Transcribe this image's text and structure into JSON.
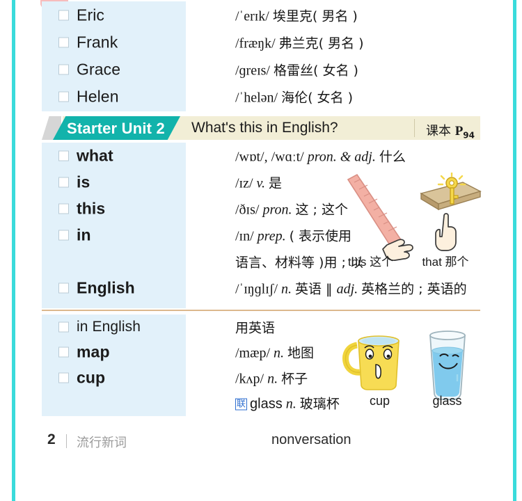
{
  "page": {
    "footer_number": "2",
    "footer_category": "流行新词",
    "footer_word": "nonversation"
  },
  "top_entries": [
    {
      "word": "Eric",
      "bold": false,
      "ipa": "/ˈerɪk/",
      "gloss": "埃里克( 男名 )"
    },
    {
      "word": "Frank",
      "bold": false,
      "ipa": "/fræŋk/",
      "gloss": "弗兰克( 男名 )"
    },
    {
      "word": "Grace",
      "bold": false,
      "ipa": "/ɡreɪs/",
      "gloss": "格雷丝( 女名 )"
    },
    {
      "word": "Helen",
      "bold": false,
      "ipa": "/ˈhelən/",
      "gloss": "海伦( 女名 )"
    }
  ],
  "unit": {
    "label": "Starter Unit 2",
    "subtitle": "What's this in English?",
    "book_label": "课本",
    "page_prefix": "P",
    "page_number": "94"
  },
  "unit_entries": [
    {
      "word": "what",
      "bold": true,
      "ipa": "/wɒt/, /wɑːt/",
      "pos": "pron. & adj.",
      "gloss": "什么"
    },
    {
      "word": "is",
      "bold": true,
      "ipa": "/ɪz/",
      "pos": "v.",
      "gloss": "是"
    },
    {
      "word": "this",
      "bold": true,
      "ipa": "/ðɪs/",
      "pos": "pron.",
      "gloss": "这 ; 这个"
    },
    {
      "word": "in",
      "bold": true,
      "ipa": "/ɪn/",
      "pos": "prep.",
      "gloss": "( 表示使用"
    },
    {
      "word": "",
      "bold": true,
      "ipa": "",
      "pos": "",
      "gloss": "语言、材料等 )用 ; 以"
    },
    {
      "word": "English",
      "bold": true,
      "ipa": "/ˈɪŋɡlɪʃ/",
      "pos": "n.",
      "gloss": "英语 ‖ ",
      "pos2": "adj.",
      "gloss2": "英格兰的 ; 英语的"
    }
  ],
  "phrase_entries": [
    {
      "word": "in English",
      "bold": false,
      "ipa": "",
      "pos": "",
      "gloss": "用英语"
    },
    {
      "word": "map",
      "bold": true,
      "ipa": "/mæp/",
      "pos": "n.",
      "gloss": "地图"
    },
    {
      "word": "cup",
      "bold": true,
      "ipa": "/kʌp/",
      "pos": "n.",
      "gloss": "杯子"
    }
  ],
  "related_note": {
    "badge": "联",
    "word": "glass",
    "pos": "n.",
    "gloss": "玻璃杯"
  },
  "illustrations": {
    "this_caption": "this 这个",
    "that_caption": "that 那个",
    "cup_caption": "cup",
    "glass_caption": "glass"
  },
  "colors": {
    "teal": "#12b3ab",
    "edge_teal": "#3adbdb",
    "header_cream": "#f2eed6",
    "word_column": "#e2f1fa",
    "divider": "#dcb88d",
    "pink_tab": "#f7bcbc",
    "blue_badge": "#2f6fd0"
  }
}
